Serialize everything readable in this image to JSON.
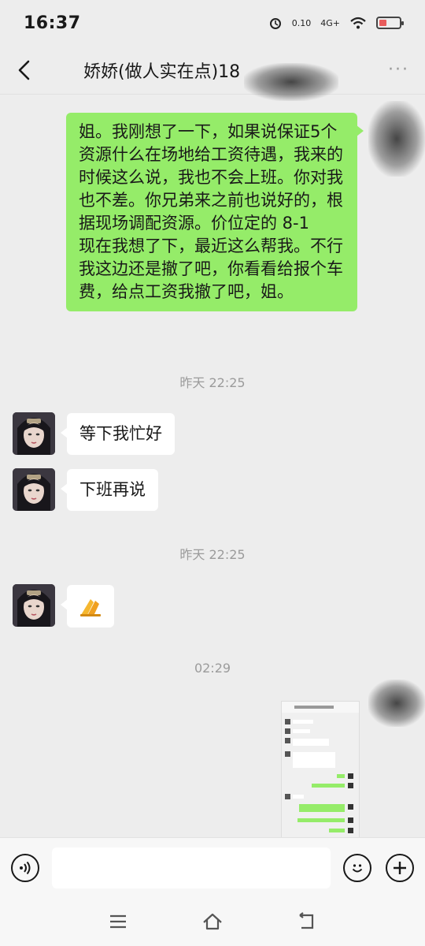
{
  "status": {
    "time": "16:37",
    "speed": "0.10",
    "network": "4G+"
  },
  "header": {
    "title": "娇娇(做人实在点)18"
  },
  "messages": {
    "m1": "姐。我刚想了一下，如果说保证5个资源什么在场地给工资待遇，我来的时候这么说，我也不会上班。你对我也不差。你兄弟来之前也说好的，根据现场调配资源。价位定的 8-1\n现在我想了下，最近这么帮我。不行我这边还是撤了吧，你看看给报个车费，给点工资我撤了吧，姐。",
    "t1": "昨天 22:25",
    "m2": "等下我忙好",
    "m3": "下班再说",
    "t2": "昨天 22:25",
    "m4": "🙏",
    "t3": "02:29"
  },
  "avatar": {
    "name": "avatar-female"
  },
  "colors": {
    "sent_bubble": "#95ec69",
    "received_bubble": "#ffffff",
    "background": "#ededed"
  },
  "icons": [
    "back-icon",
    "more-icon",
    "voice-icon",
    "emoji-icon",
    "plus-icon",
    "menu-icon",
    "home-icon",
    "return-icon"
  ]
}
